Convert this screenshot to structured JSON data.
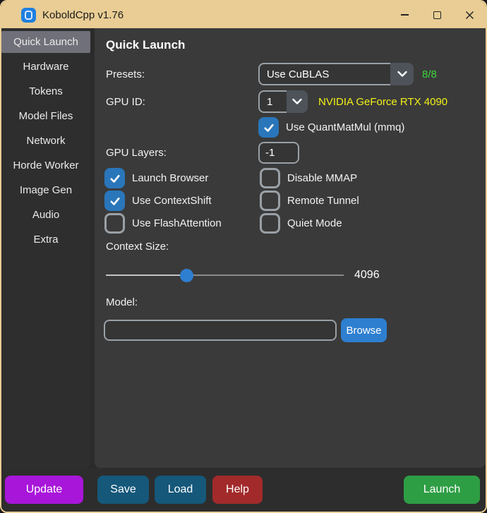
{
  "window": {
    "title": "KoboldCpp v1.76"
  },
  "sidebar": {
    "items": [
      {
        "label": "Quick Launch",
        "active": true
      },
      {
        "label": "Hardware",
        "active": false
      },
      {
        "label": "Tokens",
        "active": false
      },
      {
        "label": "Model Files",
        "active": false
      },
      {
        "label": "Network",
        "active": false
      },
      {
        "label": "Horde Worker",
        "active": false
      },
      {
        "label": "Image Gen",
        "active": false
      },
      {
        "label": "Audio",
        "active": false
      },
      {
        "label": "Extra",
        "active": false
      }
    ]
  },
  "main": {
    "heading": "Quick Launch",
    "presets": {
      "label": "Presets:",
      "value": "Use CuBLAS",
      "status": "8/8"
    },
    "gpu": {
      "label": "GPU ID:",
      "value": "1",
      "device": "NVIDIA GeForce RTX 4090"
    },
    "quantmatmul": {
      "label": "Use QuantMatMul (mmq)",
      "checked": true
    },
    "gpu_layers": {
      "label": "GPU Layers:",
      "value": "-1"
    },
    "checkboxes": [
      {
        "label": "Launch Browser",
        "checked": true
      },
      {
        "label": "Disable MMAP",
        "checked": false
      },
      {
        "label": "Use ContextShift",
        "checked": true
      },
      {
        "label": "Remote Tunnel",
        "checked": false
      },
      {
        "label": "Use FlashAttention",
        "checked": false
      },
      {
        "label": "Quiet Mode",
        "checked": false
      }
    ],
    "context_size": {
      "label": "Context Size:",
      "value": "4096",
      "slider_percent": 34
    },
    "model": {
      "label": "Model:",
      "value": "",
      "browse_label": "Browse"
    }
  },
  "footer": {
    "update": "Update",
    "save": "Save",
    "load": "Load",
    "help": "Help",
    "launch": "Launch"
  },
  "colors": {
    "titlebar_tan": "#e9cd94",
    "main_bg": "#3a3a3a",
    "sidebar_bg": "#2e2e2e",
    "selected_item": "#70707a",
    "checkbox_checked": "#2a76ba",
    "accent_blue": "#2e7fd0",
    "status_green": "#3cd63c",
    "gpu_yellow": "#f2f218",
    "btn_update": "#a816d9",
    "btn_saveload": "#15587a",
    "btn_help": "#a22a2a",
    "btn_launch": "#2e9e44"
  }
}
